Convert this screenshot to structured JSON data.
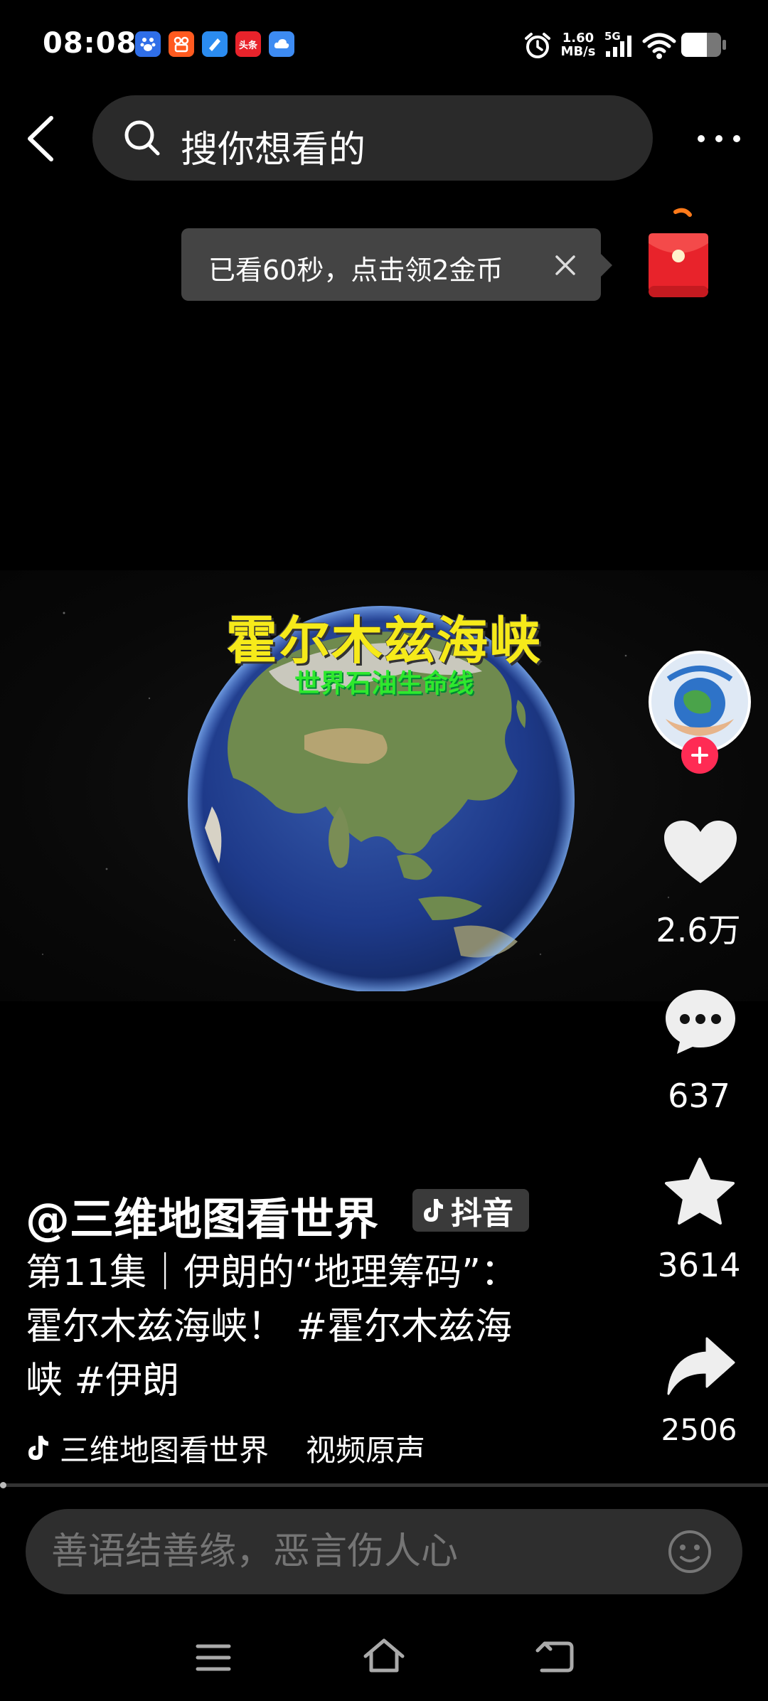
{
  "status_bar": {
    "time": "08:08",
    "network_speed_value": "1.60",
    "network_speed_unit": "MB/s",
    "network_type": "5G",
    "app_icons": [
      "baidu-icon",
      "kuaishou-icon",
      "news-app-icon",
      "toutiao-icon",
      "cloud-app-icon"
    ],
    "toutiao_label": "头条"
  },
  "search": {
    "placeholder": "搜你想看的"
  },
  "reward_tip": {
    "text": "已看60秒，点击领2金币"
  },
  "video": {
    "title": "霍尔木兹海峡",
    "subtitle": "世界石油生命线"
  },
  "actions": {
    "likes": "2.6万",
    "comments": "637",
    "favorites": "3614",
    "shares": "2506"
  },
  "post": {
    "author": "@三维地图看世界",
    "badge": "抖音",
    "description": "第11集｜伊朗的“地理筹码”：霍尔木兹海峡！ #霍尔木兹海峡 #伊朗",
    "music_author": "三维地图看世界",
    "music_title": "视频原声"
  },
  "comment": {
    "placeholder": "善语结善缘，恶言伤人心"
  },
  "colors": {
    "follow_badge": "#ff2b54",
    "video_title": "#f6ea1a",
    "video_subtitle": "#2ee82e",
    "redpacket": "#e8232b"
  }
}
